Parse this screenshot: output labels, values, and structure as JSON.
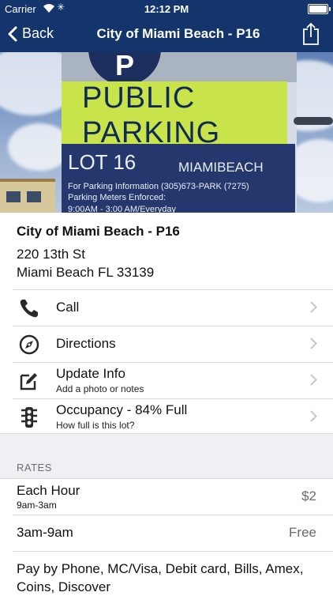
{
  "status_bar": {
    "carrier": "Carrier",
    "time": "12:12 PM"
  },
  "nav": {
    "back_label": "Back",
    "title": "City of Miami Beach - P16"
  },
  "hero_sign": {
    "line1": "PUBLIC",
    "line2": "PARKING",
    "lot": "LOT 16",
    "brand": "MIAMIBEACH",
    "info1": "For Parking Information (305)673-PARK (7275)",
    "info2": "Parking Meters Enforced:",
    "info3": "9:00AM - 3:00 AM/Everyday"
  },
  "location": {
    "name": "City of Miami Beach - P16",
    "street": "220 13th St",
    "city": "Miami Beach FL 33139"
  },
  "actions": [
    {
      "label": "Call",
      "icon": "phone-icon"
    },
    {
      "label": "Directions",
      "icon": "compass-icon"
    },
    {
      "label": "Update Info",
      "sub": "Add a photo or notes",
      "icon": "edit-icon"
    },
    {
      "label": "Occupancy - 84% Full",
      "sub": "How full is this lot?",
      "icon": "traffic-light-icon"
    }
  ],
  "rates": {
    "header": "RATES",
    "items": [
      {
        "title": "Each Hour",
        "sub": "9am-3am",
        "value": "$2"
      },
      {
        "title": "3am-9am",
        "value": "Free"
      }
    ],
    "payment": "Pay by Phone, MC/Visa, Debit card, Bills, Amex, Coins, Discover"
  },
  "colors": {
    "nav_bg": "#13356b",
    "sign_yellow": "#c9e34a",
    "sign_blue": "#24386d"
  }
}
